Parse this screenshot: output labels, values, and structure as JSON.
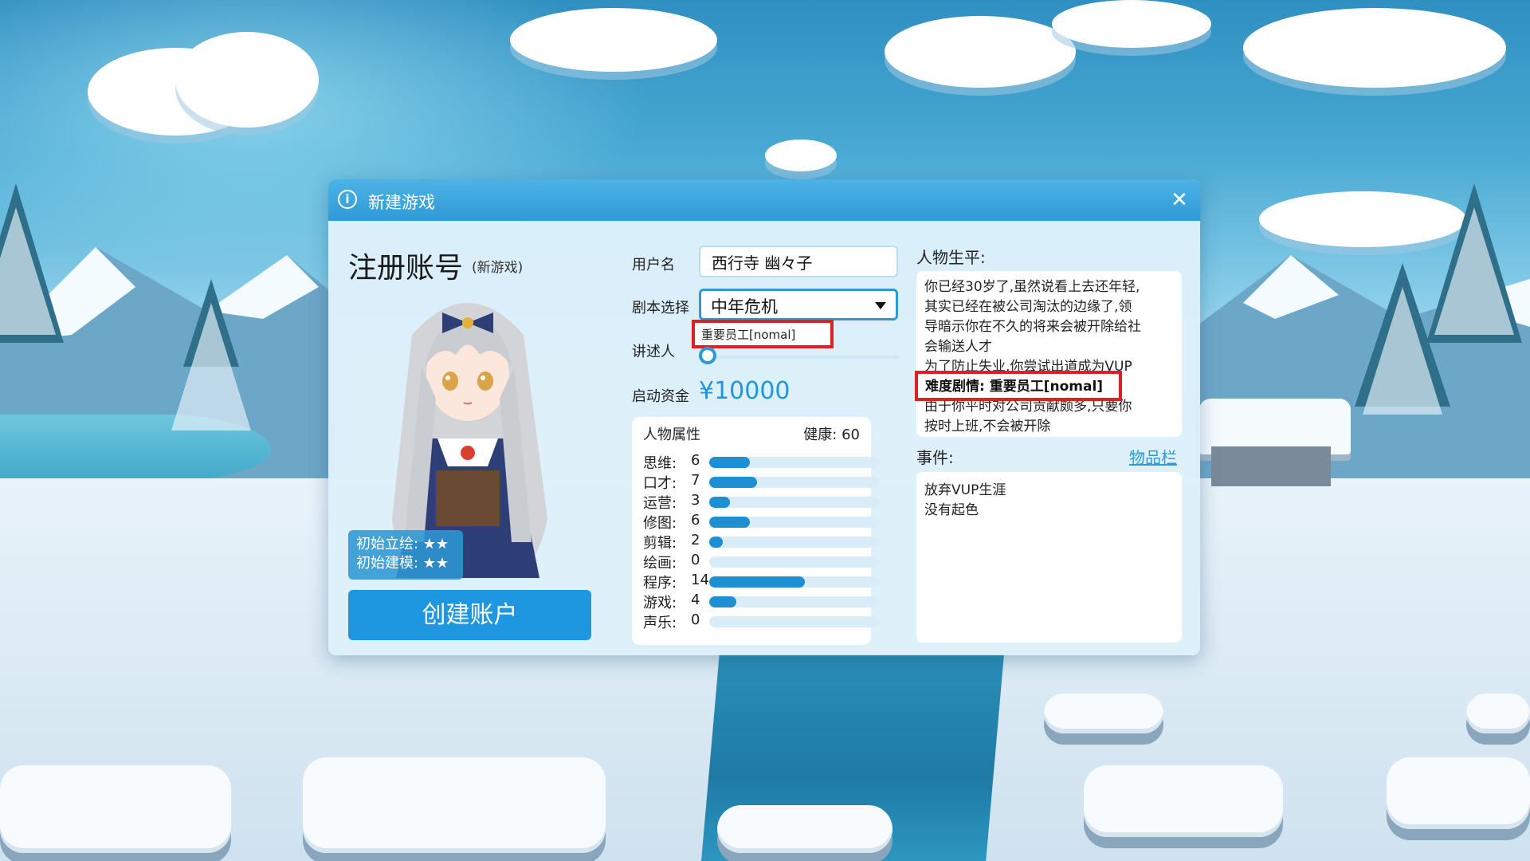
{
  "dialog": {
    "title": "新建游戏",
    "close_glyph": "✕"
  },
  "register": {
    "title": "注册账号",
    "subtitle": "(新游戏)",
    "stars": {
      "portrait_label": "初始立绘: ★★",
      "model_label": "初始建模: ★★"
    },
    "create_button": "创建账户"
  },
  "form": {
    "username_label": "用户名",
    "username_value": "西行寺 幽々子",
    "script_label": "剧本选择",
    "script_value": "中年危机",
    "dropdown_option": "重要员工[nomal]",
    "narrator_label": "讲述人",
    "narrator_level": 0,
    "funds_label": "启动资金",
    "funds_value": "¥10000"
  },
  "attributes": {
    "title": "人物属性",
    "health": "健康: 60",
    "max": 25,
    "items": [
      {
        "label": "思维:",
        "value": 6
      },
      {
        "label": "口才:",
        "value": 7
      },
      {
        "label": "运营:",
        "value": 3
      },
      {
        "label": "修图:",
        "value": 6
      },
      {
        "label": "剪辑:",
        "value": 2
      },
      {
        "label": "绘画:",
        "value": 0
      },
      {
        "label": "程序:",
        "value": 14
      },
      {
        "label": "游戏:",
        "value": 4
      },
      {
        "label": "声乐:",
        "value": 0
      }
    ]
  },
  "bio": {
    "label": "人物生平:",
    "lines": [
      "你已经30岁了,虽然说看上去还年轻,",
      "其实已经在被公司淘汰的边缘了,领",
      "导暗示你在不久的将来会被开除给社",
      "会输送人才",
      "为了防止失业,你尝试出道成为VUP"
    ],
    "difficulty": "难度剧情: 重要员工[nomal]",
    "tail_lines": [
      "由于你平时对公司贡献颇多,只要你",
      "按时上班,不会被开除"
    ]
  },
  "events": {
    "label": "事件:",
    "inventory_link": "物品栏",
    "items": [
      "放弃VUP生涯",
      "没有起色"
    ]
  },
  "colors": {
    "accent": "#1f96e0",
    "highlight": "#e02020"
  }
}
